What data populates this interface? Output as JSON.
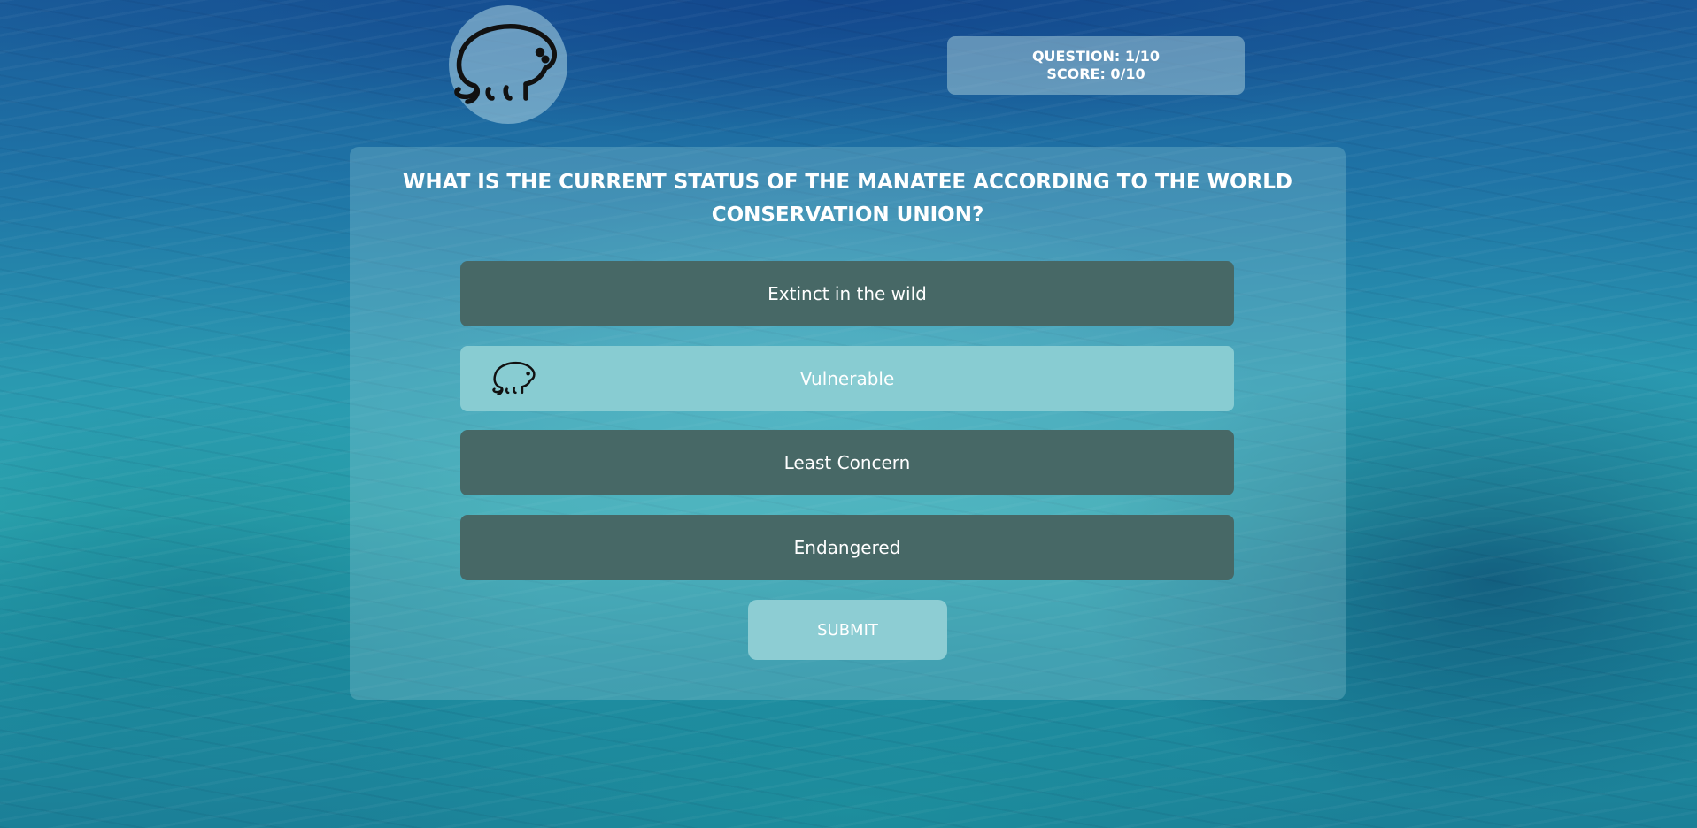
{
  "header": {
    "logo_icon": "manatee-icon",
    "question_counter": "QUESTION: 1/10",
    "score": "SCORE: 0/10"
  },
  "quiz": {
    "question": "WHAT IS THE CURRENT STATUS OF THE MANATEE ACCORDING TO THE WORLD CONSERVATION UNION?",
    "answers": [
      {
        "label": "Extinct in the wild",
        "selected": false
      },
      {
        "label": "Vulnerable",
        "selected": true,
        "icon": "manatee-icon"
      },
      {
        "label": "Least Concern",
        "selected": false
      },
      {
        "label": "Endangered",
        "selected": false
      }
    ],
    "submit_label": "SUBMIT"
  },
  "colors": {
    "answer_default": "#476866",
    "answer_selected": "#88ccd2",
    "submit": "#8dcdd3",
    "text": "#ffffff"
  }
}
